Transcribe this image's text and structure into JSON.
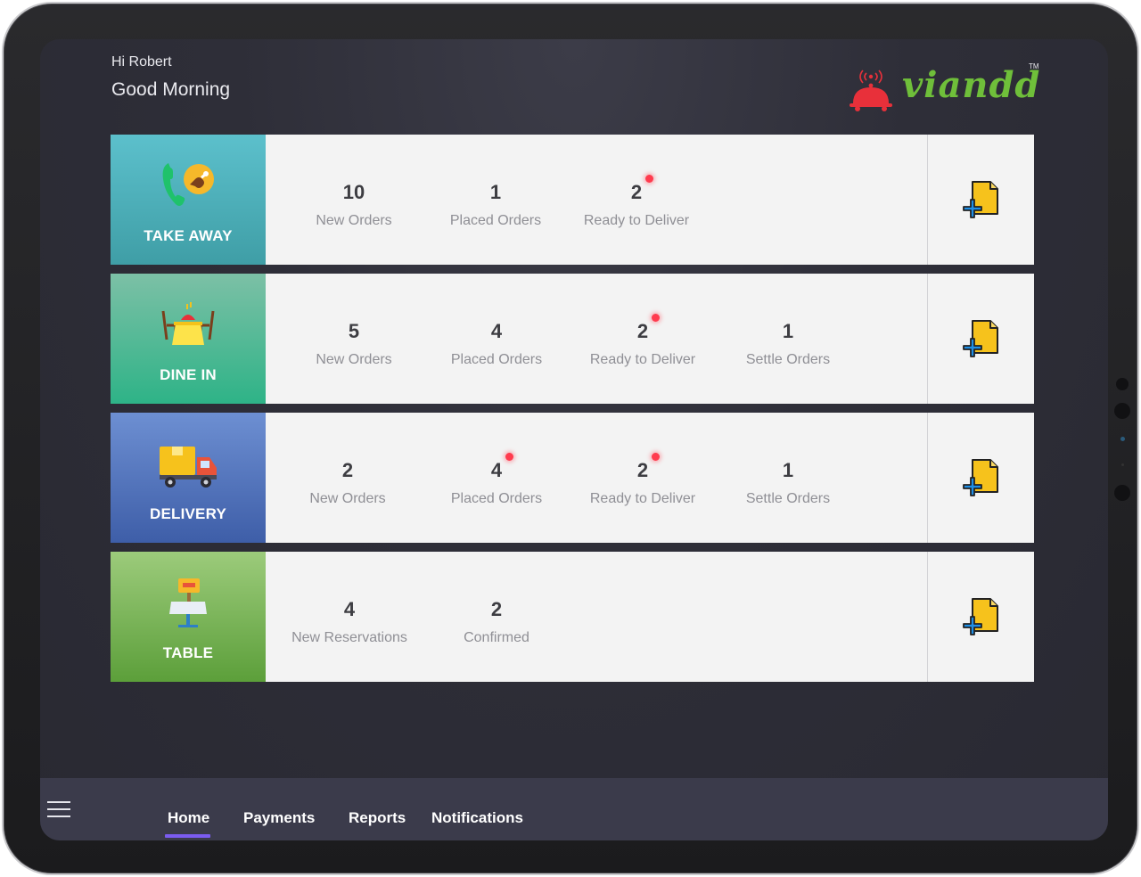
{
  "header": {
    "greeting": "Hi Robert",
    "salutation": "Good Morning",
    "logo_text": "viandd",
    "logo_tm": "TM"
  },
  "colors": {
    "accent": "#7b5cf0",
    "notification_dot": "#ff3b4e",
    "logo_green": "#6fbf3a",
    "logo_red": "#e8303a"
  },
  "rows": [
    {
      "title": "TAKE AWAY",
      "icon": "phone-food-icon",
      "stats": [
        {
          "value": "10",
          "label": "New Orders",
          "alert": false
        },
        {
          "value": "1",
          "label": "Placed Orders",
          "alert": false
        },
        {
          "value": "2",
          "label": "Ready to Deliver",
          "alert": true
        }
      ],
      "action_icon": "add-document-icon"
    },
    {
      "title": "DINE IN",
      "icon": "dining-table-icon",
      "stats": [
        {
          "value": "5",
          "label": "New Orders",
          "alert": false
        },
        {
          "value": "4",
          "label": "Placed Orders",
          "alert": false
        },
        {
          "value": "2",
          "label": "Ready to Deliver",
          "alert": true
        },
        {
          "value": "1",
          "label": "Settle Orders",
          "alert": false
        }
      ],
      "action_icon": "add-document-icon"
    },
    {
      "title": "DELIVERY",
      "icon": "delivery-truck-icon",
      "stats": [
        {
          "value": "2",
          "label": "New Orders",
          "alert": false
        },
        {
          "value": "4",
          "label": "Placed Orders",
          "alert": true
        },
        {
          "value": "2",
          "label": "Ready to Deliver",
          "alert": true
        },
        {
          "value": "1",
          "label": "Settle Orders",
          "alert": false
        }
      ],
      "action_icon": "add-document-icon"
    },
    {
      "title": "TABLE",
      "icon": "reserved-table-icon",
      "stats": [
        {
          "value": "4",
          "label": "New Reservations",
          "alert": false
        },
        {
          "value": "2",
          "label": "Confirmed",
          "alert": false
        }
      ],
      "action_icon": "add-document-icon"
    }
  ],
  "nav": {
    "items": [
      "Home",
      "Payments",
      "Reports",
      "Notifications"
    ],
    "active": "Home"
  }
}
